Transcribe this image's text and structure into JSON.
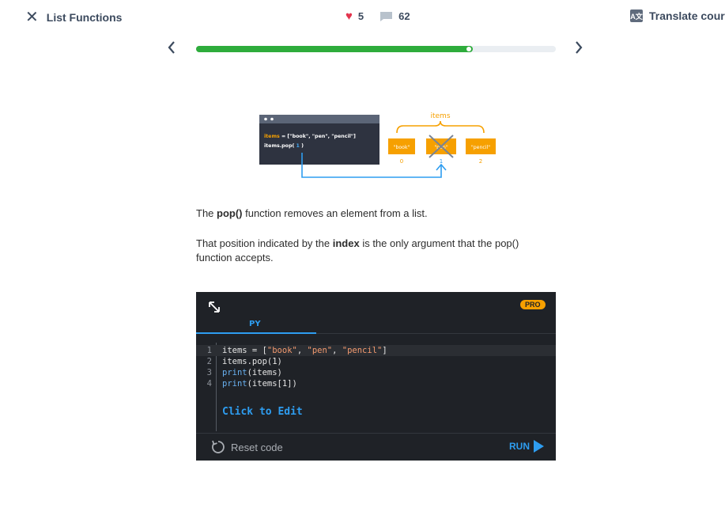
{
  "header": {
    "close_icon": "close-icon",
    "lesson_title": "List Functions",
    "likes": "5",
    "comments": "62",
    "translate_label": "Translate course",
    "translate_icon_text": "A文"
  },
  "progress": {
    "fraction": 0.77,
    "prev_icon": "chevron-left-icon",
    "next_icon": "chevron-right-icon"
  },
  "illustration": {
    "code_line1_prefix": "items",
    "code_line1_rest": " = [\"book\", \"pen\", \"pencil\"]",
    "code_line2_prefix": "items.pop(",
    "code_line2_arg": " 1 ",
    "code_line2_suffix": ")",
    "group_label": "items",
    "cells": [
      "\"book\"",
      "\"pen\"",
      "\"pencil\""
    ],
    "indices": [
      "0",
      "1",
      "2"
    ]
  },
  "lesson": {
    "p1_before": "The ",
    "p1_bold": "pop()",
    "p1_after": " function removes an element from a list.",
    "p2_before": "That position indicated by the ",
    "p2_bold": "index",
    "p2_after": " is the only argument that the pop() function accepts."
  },
  "editor": {
    "pro_badge": "PRO",
    "tab_label": "PY",
    "lines": [
      {
        "num": "1",
        "parts": [
          [
            "plain",
            "items = ["
          ],
          [
            "str",
            "\"book\""
          ],
          [
            "plain",
            ", "
          ],
          [
            "str",
            "\"pen\""
          ],
          [
            "plain",
            ", "
          ],
          [
            "str",
            "\"pencil\""
          ],
          [
            "plain",
            "]"
          ]
        ]
      },
      {
        "num": "2",
        "parts": [
          [
            "plain",
            "items.pop(1)"
          ]
        ]
      },
      {
        "num": "3",
        "parts": [
          [
            "kw",
            "print"
          ],
          [
            "plain",
            "(items)"
          ]
        ]
      },
      {
        "num": "4",
        "parts": [
          [
            "kw",
            "print"
          ],
          [
            "plain",
            "(items[1])"
          ]
        ]
      }
    ],
    "click_to_edit": "Click to Edit",
    "reset_label": "Reset code",
    "run_label": "RUN"
  },
  "colors": {
    "accent_green": "#2eac3c",
    "accent_blue": "#2e9df0",
    "heart": "#e2344d",
    "orange": "#f6a000"
  }
}
